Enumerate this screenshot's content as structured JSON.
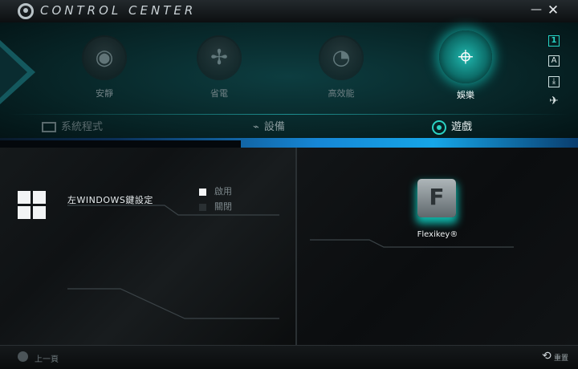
{
  "app": {
    "title": "CONTROL CENTER"
  },
  "window_controls": {
    "minimize": "—",
    "close": "✕"
  },
  "modes": [
    {
      "label": "安靜",
      "icon": "speaker-icon",
      "glyph": "◉",
      "active": false
    },
    {
      "label": "省電",
      "icon": "fan-icon",
      "glyph": "✢",
      "active": false
    },
    {
      "label": "高效能",
      "icon": "gauge-icon",
      "glyph": "◔",
      "active": false
    },
    {
      "label": "娛樂",
      "icon": "crosshair-icon",
      "glyph": "⌖",
      "active": true
    }
  ],
  "side_buttons": [
    "1",
    "A",
    "⤓",
    "✈"
  ],
  "nav_tabs": [
    {
      "label": "系統程式",
      "icon": "monitor-icon"
    },
    {
      "label": "設備",
      "icon": "plug-icon"
    },
    {
      "label": "遊戲",
      "icon": "eye-icon",
      "active": true
    }
  ],
  "windows_key": {
    "label": "左WINDOWS鍵設定",
    "options": [
      {
        "label": "啟用",
        "checked": true
      },
      {
        "label": "關閉",
        "checked": false
      }
    ]
  },
  "flexikey": {
    "letter": "F",
    "label": "Flexikey®"
  },
  "bottom": {
    "back_label": "上一頁",
    "reset_label": "重置"
  },
  "colors": {
    "accent": "#27d4c6",
    "blue_strip": "#1687d6",
    "panel": "#072426"
  }
}
